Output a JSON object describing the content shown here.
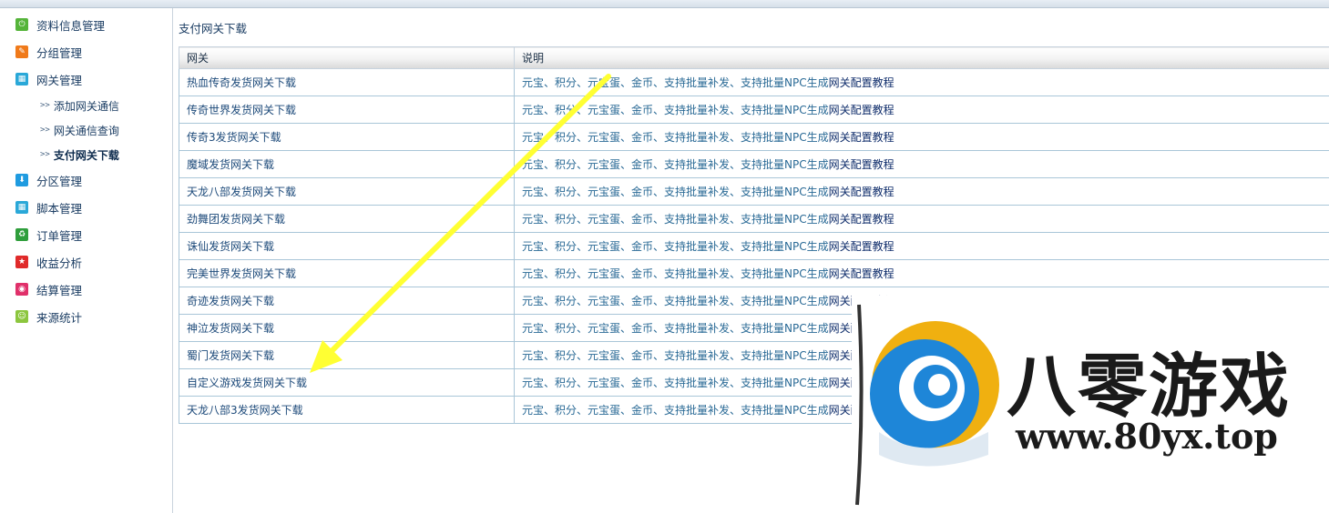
{
  "sidebar": {
    "items": [
      {
        "label": "资料信息管理",
        "icon": "power-icon",
        "color": "#55b43a"
      },
      {
        "label": "分组管理",
        "icon": "pencil-icon",
        "color": "#f07a1a"
      },
      {
        "label": "网关管理",
        "icon": "grid-icon",
        "color": "#2aa8d8"
      },
      {
        "label": "分区管理",
        "icon": "download-icon",
        "color": "#1f9be0"
      },
      {
        "label": "脚本管理",
        "icon": "grid-icon",
        "color": "#2aa8d8"
      },
      {
        "label": "订单管理",
        "icon": "recycle-icon",
        "color": "#2f9e3c"
      },
      {
        "label": "收益分析",
        "icon": "star-icon",
        "color": "#e02a2a"
      },
      {
        "label": "结算管理",
        "icon": "target-icon",
        "color": "#e0306a"
      },
      {
        "label": "来源统计",
        "icon": "smile-icon",
        "color": "#8cc63e"
      }
    ],
    "subitems": [
      {
        "label": "添加网关通信",
        "arrow": ">>"
      },
      {
        "label": "网关通信查询",
        "arrow": ">>"
      },
      {
        "label": "支付网关下载",
        "arrow": ">>"
      }
    ]
  },
  "main": {
    "title": "支付网关下载",
    "table": {
      "headers": [
        "网关",
        "说明"
      ],
      "rows": [
        {
          "gateway": "热血传奇发货网关下载",
          "desc": "元宝、积分、元宝蛋、金币、支持批量补发、支持批量NPC生成",
          "link": "网关配置教程"
        },
        {
          "gateway": "传奇世界发货网关下载",
          "desc": "元宝、积分、元宝蛋、金币、支持批量补发、支持批量NPC生成",
          "link": "网关配置教程"
        },
        {
          "gateway": "传奇3发货网关下载",
          "desc": "元宝、积分、元宝蛋、金币、支持批量补发、支持批量NPC生成",
          "link": "网关配置教程"
        },
        {
          "gateway": "魔域发货网关下载",
          "desc": "元宝、积分、元宝蛋、金币、支持批量补发、支持批量NPC生成",
          "link": "网关配置教程"
        },
        {
          "gateway": "天龙八部发货网关下载",
          "desc": "元宝、积分、元宝蛋、金币、支持批量补发、支持批量NPC生成",
          "link": "网关配置教程"
        },
        {
          "gateway": "劲舞团发货网关下载",
          "desc": "元宝、积分、元宝蛋、金币、支持批量补发、支持批量NPC生成",
          "link": "网关配置教程"
        },
        {
          "gateway": "诛仙发货网关下载",
          "desc": "元宝、积分、元宝蛋、金币、支持批量补发、支持批量NPC生成",
          "link": "网关配置教程"
        },
        {
          "gateway": "完美世界发货网关下载",
          "desc": "元宝、积分、元宝蛋、金币、支持批量补发、支持批量NPC生成",
          "link": "网关配置教程"
        },
        {
          "gateway": "奇迹发货网关下载",
          "desc": "元宝、积分、元宝蛋、金币、支持批量补发、支持批量NPC生成",
          "link": "网关配置教程"
        },
        {
          "gateway": "神泣发货网关下载",
          "desc": "元宝、积分、元宝蛋、金币、支持批量补发、支持批量NPC生成",
          "link": "网关配置教程"
        },
        {
          "gateway": "蜀门发货网关下载",
          "desc": "元宝、积分、元宝蛋、金币、支持批量补发、支持批量NPC生成",
          "link": "网关配置教程"
        },
        {
          "gateway": "自定义游戏发货网关下载",
          "desc": "元宝、积分、元宝蛋、金币、支持批量补发、支持批量NPC生成",
          "link": "网关配置教程"
        },
        {
          "gateway": "天龙八部3发货网关下载",
          "desc": "元宝、积分、元宝蛋、金币、支持批量补发、支持批量NPC生成",
          "link": "网关配置教程"
        }
      ]
    }
  },
  "watermark": {
    "name": "八零游戏",
    "url": "www.80yx.top"
  },
  "colors": {
    "arrow": "#ffff33",
    "border": "#a9c6d8"
  }
}
